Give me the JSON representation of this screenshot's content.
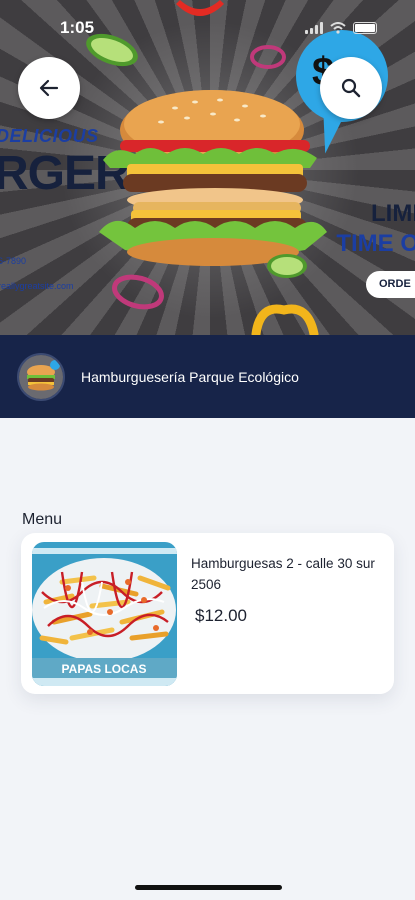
{
  "status_bar": {
    "time": "1:05"
  },
  "banner": {
    "delicious": "DELICIOUS",
    "headline": "RGER",
    "phone": "6-7890",
    "website": "reallygreatsite.com",
    "limited_line1": "LIMI",
    "limited_line2": "TIME O",
    "order_label": "ORDE",
    "price_symbol": "$"
  },
  "header": {
    "back_icon": "arrow-left-icon",
    "search_icon": "search-icon"
  },
  "restaurant": {
    "name": "Hamburguesería Parque Ecológico"
  },
  "menu": {
    "heading": "Menu",
    "items": [
      {
        "title": "Hamburguesas 2 - calle 30 sur 2506",
        "price": "$12.00",
        "image_caption": "PAPAS LOCAS"
      }
    ]
  },
  "colors": {
    "header_bar": "#172449",
    "background": "#f2f4f8",
    "accent_blue": "#2ea7e6"
  }
}
